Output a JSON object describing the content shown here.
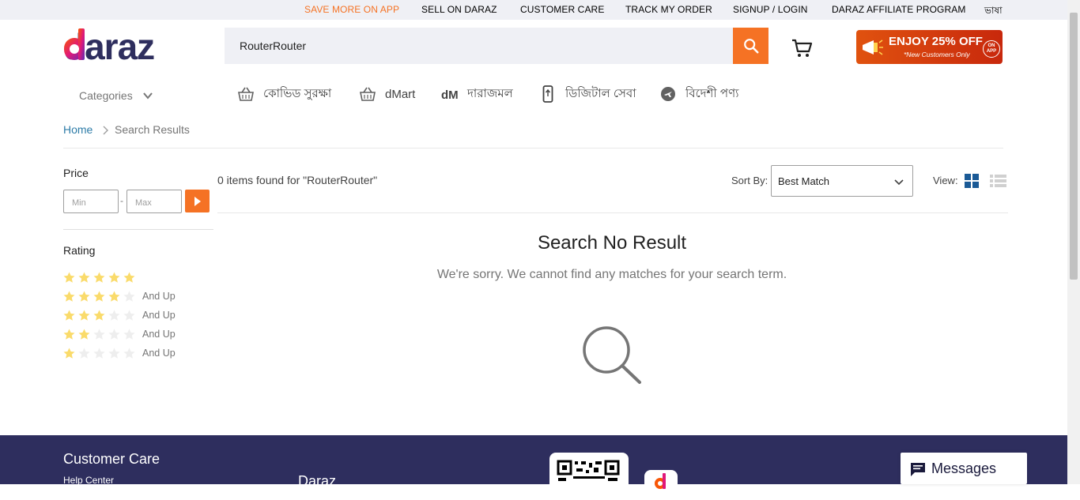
{
  "topbar": {
    "links": [
      {
        "label": "SAVE MORE ON APP",
        "color": "#f57224"
      },
      {
        "label": "SELL ON DARAZ"
      },
      {
        "label": "CUSTOMER CARE"
      },
      {
        "label": "TRACK MY ORDER"
      },
      {
        "label": "SIGNUP / LOGIN"
      },
      {
        "label": "DARAZ AFFILIATE PROGRAM"
      },
      {
        "label": "ভাষা"
      }
    ]
  },
  "header": {
    "logo_text": "daraz",
    "search_value": "RouterRouter",
    "promo_title": "ENJOY 25% OFF",
    "promo_subtitle": "*New Customers Only",
    "promo_badge": "ON APP"
  },
  "nav": {
    "categories_label": "Categories",
    "items": [
      {
        "label": "কোভিড সুরক্ষা",
        "icon": "basket-icon"
      },
      {
        "label": "dMart",
        "icon": "basket-icon"
      },
      {
        "label": "দারাজমল",
        "icon": "dm-mall-icon"
      },
      {
        "label": "ডিজিটাল সেবা",
        "icon": "phone-icon"
      },
      {
        "label": "বিদেশী পণ্য",
        "icon": "airplane-icon"
      }
    ]
  },
  "breadcrumb": {
    "home": "Home",
    "current": "Search Results"
  },
  "filters": {
    "price_title": "Price",
    "min_placeholder": "Min",
    "max_placeholder": "Max",
    "rating_title": "Rating",
    "and_up": "And Up",
    "ratings": [
      5,
      4,
      3,
      2,
      1
    ]
  },
  "results": {
    "count_text": "0 items found for \"RouterRouter\"",
    "sort_label": "Sort By:",
    "sort_value": "Best Match",
    "view_label": "View:",
    "no_result_title": "Search No Result",
    "no_result_message": "We're sorry. We cannot find any matches for your search term."
  },
  "footer": {
    "customer_care": "Customer Care",
    "help_center": "Help Center",
    "daraz": "Daraz",
    "messages": "Messages"
  },
  "colors": {
    "accent": "#f57224",
    "footer_bg": "#2e2e5e",
    "star": "#fadb6b",
    "star_empty": "#eeeeee"
  }
}
